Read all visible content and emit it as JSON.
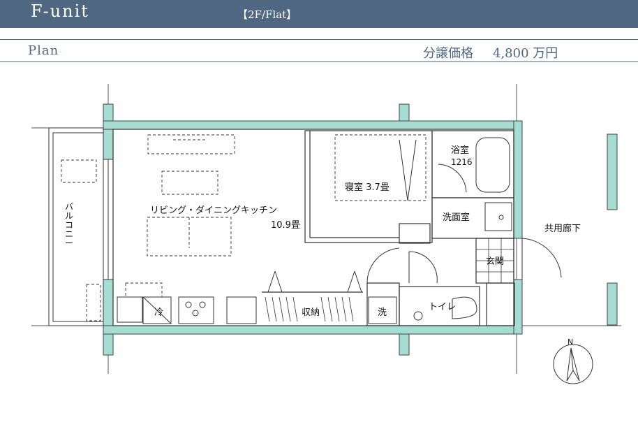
{
  "header": {
    "unit_name": "F-unit",
    "unit_type": "【2F/Flat】"
  },
  "subheader": {
    "plan_label": "Plan",
    "price_label": "分譲価格",
    "price_value": "4,800 万円"
  },
  "rooms": {
    "ldk": "リビング・ダイニングキッチン",
    "ldk_size": "10.9畳",
    "bedroom": "寝室 3.7畳",
    "bath": "浴室",
    "bath_size": "1216",
    "washroom": "洗面室",
    "entrance": "玄関",
    "toilet": "トイレ",
    "storage": "収納",
    "fridge": "冷",
    "washer": "洗",
    "balcony": "バルコニー",
    "corridor": "共用廊下"
  },
  "compass": {
    "north": "N"
  },
  "colors": {
    "header": "#4f6780",
    "wall": "#a6ddd3",
    "outline": "#333333"
  }
}
